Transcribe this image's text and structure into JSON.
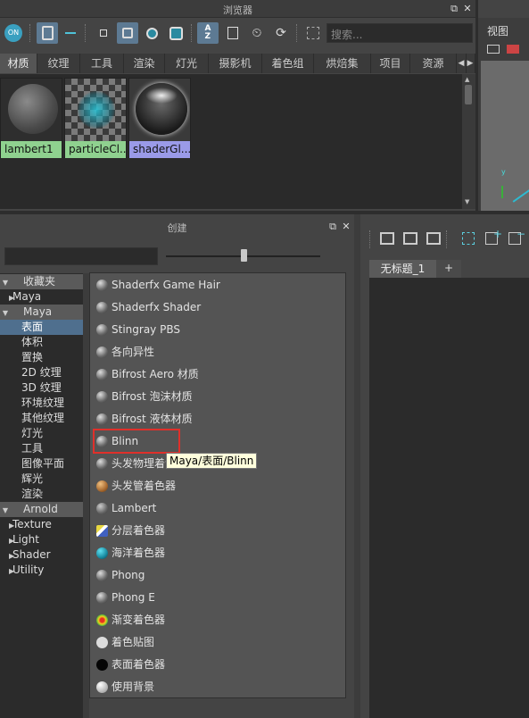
{
  "browser": {
    "title": "浏览器",
    "search_placeholder": "搜索...",
    "tabs": [
      "材质",
      "纹理",
      "工具",
      "渲染",
      "灯光",
      "摄影机",
      "着色组",
      "烘焙集",
      "项目",
      "资源"
    ],
    "swatches": [
      {
        "label": "lambert1",
        "color": "#8fd18f"
      },
      {
        "label": "particleCl...",
        "color": "#8fd18f"
      },
      {
        "label": "shaderGl...",
        "color": "#9a9ae8"
      }
    ]
  },
  "right_header": {
    "menu1": "视图"
  },
  "create": {
    "title": "创建",
    "categories": [
      {
        "label": "收藏夹",
        "kind": "header"
      },
      {
        "label": "Maya",
        "kind": "sub"
      },
      {
        "label": "Maya",
        "kind": "header"
      },
      {
        "label": "表面",
        "kind": "selected"
      },
      {
        "label": "体积",
        "kind": "item"
      },
      {
        "label": "置换",
        "kind": "item"
      },
      {
        "label": "2D 纹理",
        "kind": "item"
      },
      {
        "label": "3D 纹理",
        "kind": "item"
      },
      {
        "label": "环境纹理",
        "kind": "item"
      },
      {
        "label": "其他纹理",
        "kind": "item"
      },
      {
        "label": "灯光",
        "kind": "item"
      },
      {
        "label": "工具",
        "kind": "item"
      },
      {
        "label": "图像平面",
        "kind": "item"
      },
      {
        "label": "辉光",
        "kind": "item"
      },
      {
        "label": "渲染",
        "kind": "item"
      },
      {
        "label": "Arnold",
        "kind": "header"
      },
      {
        "label": "Texture",
        "kind": "sub"
      },
      {
        "label": "Light",
        "kind": "sub"
      },
      {
        "label": "Shader",
        "kind": "sub"
      },
      {
        "label": "Utility",
        "kind": "sub"
      }
    ],
    "nodes": [
      {
        "label": "Shaderfx Game Hair",
        "icon": "grey-sphere-icon"
      },
      {
        "label": "Shaderfx Shader",
        "icon": "grey-sphere-icon"
      },
      {
        "label": "Stingray PBS",
        "icon": "grey-sphere-icon"
      },
      {
        "label": "各向异性",
        "icon": "grey-sphere-icon"
      },
      {
        "label": "Bifrost Aero 材质",
        "icon": "grey-sphere-icon"
      },
      {
        "label": "Bifrost 泡沫材质",
        "icon": "grey-sphere-icon"
      },
      {
        "label": "Bifrost 液体材质",
        "icon": "grey-sphere-icon"
      },
      {
        "label": "Blinn",
        "icon": "grey-sphere-icon"
      },
      {
        "label": "头发物理着色器",
        "icon": "grey-sphere-icon"
      },
      {
        "label": "头发管着色器",
        "icon": "hair-tube-icon"
      },
      {
        "label": "Lambert",
        "icon": "grey-sphere-icon"
      },
      {
        "label": "分层着色器",
        "icon": "layered-icon"
      },
      {
        "label": "海洋着色器",
        "icon": "ocean-icon"
      },
      {
        "label": "Phong",
        "icon": "grey-sphere-icon"
      },
      {
        "label": "Phong E",
        "icon": "grey-sphere-icon"
      },
      {
        "label": "渐变着色器",
        "icon": "ramp-icon"
      },
      {
        "label": "着色贴图",
        "icon": "white-sphere-icon"
      },
      {
        "label": "表面着色器",
        "icon": "black-sphere-icon"
      },
      {
        "label": "使用背景",
        "icon": "bg-sphere-icon"
      }
    ],
    "tooltip": "Maya/表面/Blinn"
  },
  "hypershade_tab": {
    "label": "无标题_1",
    "plus": "+"
  }
}
